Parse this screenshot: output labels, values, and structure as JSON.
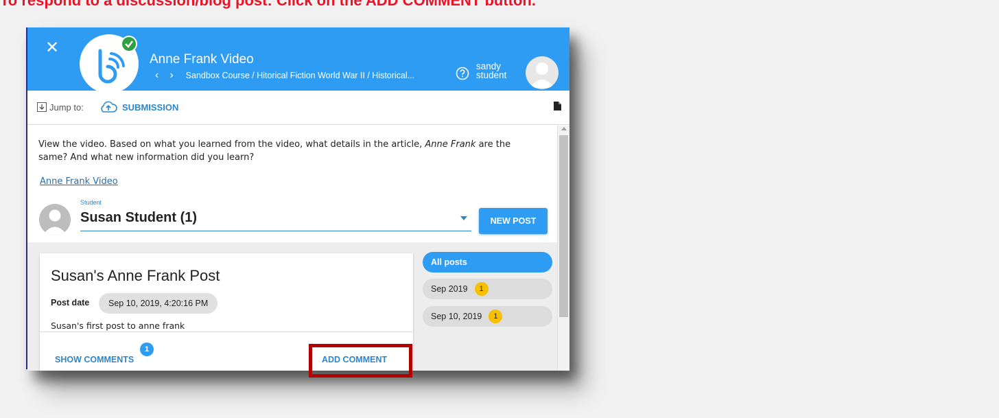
{
  "instruction": "To respond to a discussion/blog post: Click on the ADD COMMENT button.",
  "header": {
    "close_label": "✕",
    "title": "Anne Frank Video",
    "prev_label": "‹",
    "next_label": "›",
    "breadcrumb": "Sandbox Course / Hitorical Fiction World War II / Historical...",
    "user_first": "sandy",
    "user_last": "student"
  },
  "jumpbar": {
    "jump_label": "Jump to:",
    "submission_label": "SUBMISSION"
  },
  "content": {
    "prompt_part1": "View the video.  Based on what you learned from the video, what details in the article, ",
    "prompt_italic": "Anne Frank",
    "prompt_part2": " are the same? And what new information did you learn?",
    "video_link": "Anne Frank Video",
    "student_caption": "Student",
    "student_value": "Susan Student (1)",
    "new_post_label": "NEW POST"
  },
  "post": {
    "title": "Susan's Anne Frank Post",
    "date_label": "Post date",
    "date_value": "Sep 10, 2019, 4:20:16 PM",
    "body": "Susan's first post to anne frank",
    "show_comments_label": "SHOW COMMENTS",
    "comment_count": "1",
    "add_comment_label": "ADD COMMENT"
  },
  "filters": {
    "all_posts": "All posts",
    "items": [
      {
        "label": "Sep 2019",
        "count": "1"
      },
      {
        "label": "Sep 10, 2019",
        "count": "1"
      }
    ]
  },
  "colors": {
    "header_blue": "#2e9cf3",
    "link_blue": "#2e86c8",
    "badge_yellow": "#f6c000",
    "highlight_red": "#b00000",
    "instruction_red": "#e8142a",
    "check_green": "#2e9f42"
  },
  "icons": {
    "close": "close-icon",
    "logo": "logo-icon",
    "check": "check-icon",
    "help": "help-icon",
    "download": "download-icon",
    "upload": "cloud-upload-icon",
    "document": "document-icon"
  }
}
